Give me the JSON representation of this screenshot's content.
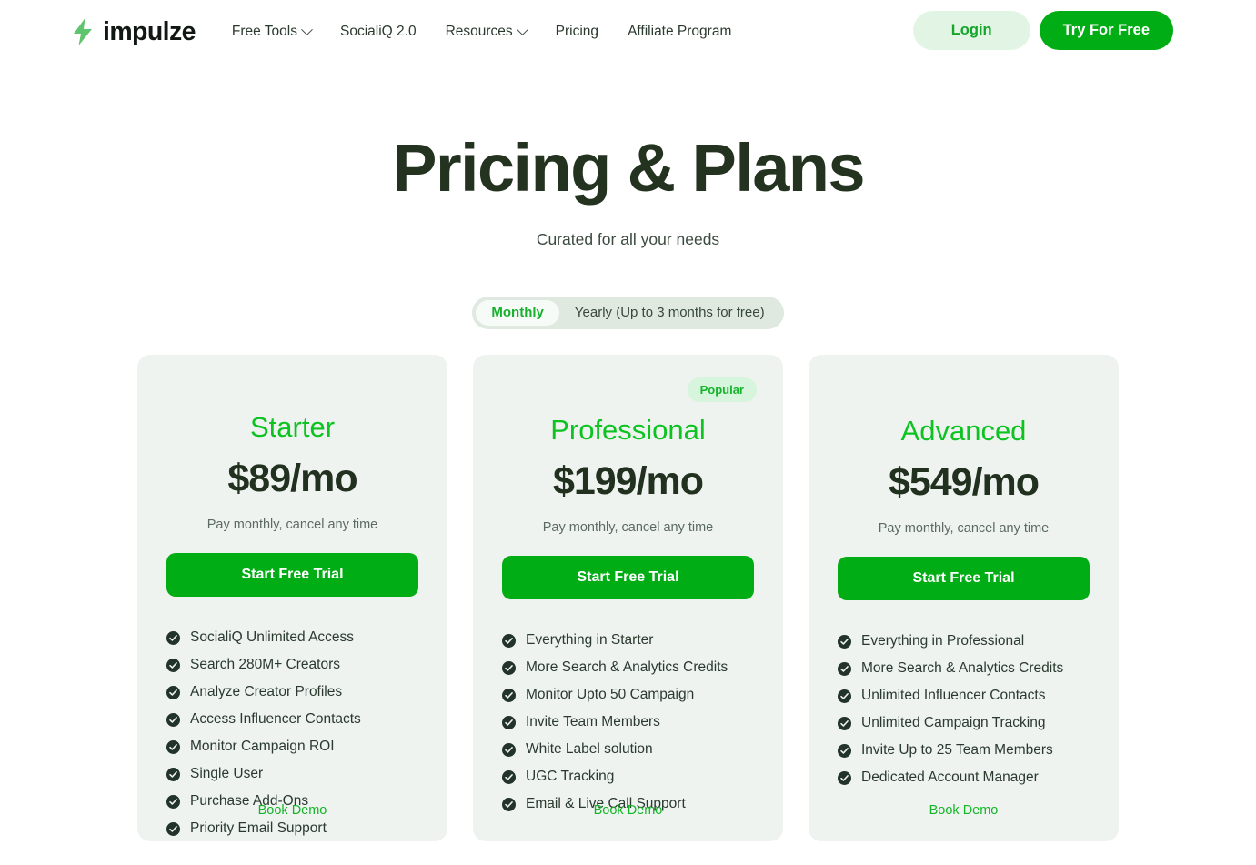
{
  "brand": {
    "name": "impulze",
    "logo_icon": "lightning-bolt-icon",
    "logo_color": "#5ec46d"
  },
  "header": {
    "nav": [
      {
        "label": "Free Tools",
        "has_dropdown": true
      },
      {
        "label": "SocialiQ 2.0",
        "has_dropdown": false
      },
      {
        "label": "Resources",
        "has_dropdown": true
      },
      {
        "label": "Pricing",
        "has_dropdown": false
      },
      {
        "label": "Affiliate Program",
        "has_dropdown": false
      }
    ],
    "login_label": "Login",
    "try_label": "Try For Free"
  },
  "hero": {
    "title": "Pricing & Plans",
    "subtitle": "Curated for all your needs"
  },
  "billing_toggle": {
    "options": [
      {
        "label": "Monthly",
        "active": true
      },
      {
        "label": "Yearly (Up to 3 months for free)",
        "active": false
      }
    ]
  },
  "plans": [
    {
      "name": "Starter",
      "price": "$89/mo",
      "note": "Pay monthly, cancel any time",
      "cta_label": "Start Free Trial",
      "demo_label": "Book Demo",
      "badge": null,
      "features": [
        "SocialiQ Unlimited Access",
        "Search 280M+ Creators",
        "Analyze Creator Profiles",
        "Access Influencer Contacts",
        "Monitor Campaign ROI",
        "Single User",
        "Purchase Add-Ons",
        "Priority Email Support"
      ]
    },
    {
      "name": "Professional",
      "price": "$199/mo",
      "note": "Pay monthly, cancel any time",
      "cta_label": "Start Free Trial",
      "demo_label": "Book Demo",
      "badge": "Popular",
      "features": [
        "Everything in Starter",
        "More Search & Analytics Credits",
        "Monitor Upto 50 Campaign",
        "Invite Team Members",
        "White Label solution",
        "UGC Tracking",
        "Email & Live Call Support"
      ]
    },
    {
      "name": "Advanced",
      "price": "$549/mo",
      "note": "Pay monthly, cancel any time",
      "cta_label": "Start Free Trial",
      "demo_label": "Book Demo",
      "badge": null,
      "features": [
        "Everything in Professional",
        "More Search & Analytics Credits",
        "Unlimited Influencer Contacts",
        "Unlimited Campaign Tracking",
        "Invite Up to 25 Team Members",
        "Dedicated Account Manager"
      ]
    }
  ],
  "colors": {
    "brand_green": "#00ad14",
    "plan_name_green": "#0cc321",
    "card_bg": "#eff3f0",
    "title_dark": "#23331f",
    "badge_bg": "#d7f5dc",
    "login_bg": "#e2f5e5"
  },
  "icons": {
    "check": "check-circle-icon",
    "chevron": "chevron-down-icon"
  }
}
